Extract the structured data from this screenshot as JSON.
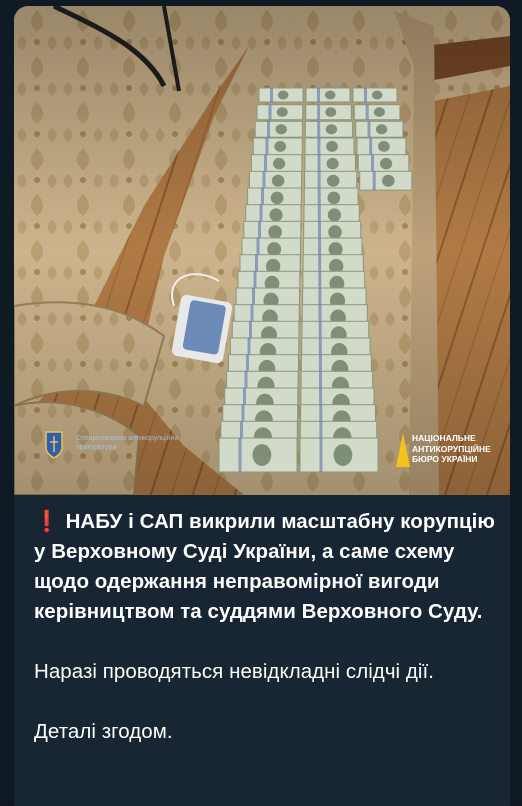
{
  "photo": {
    "description_icon": "photo-image",
    "sap_logo_text": "Спеціалізована антикорупційна прокуратура",
    "nabu_logo_text": "НАЦІОНАЛЬНЕ\nАНТИКОРУПЦІЙНЕ\nБЮРО УКРАЇНИ",
    "sofa_color": "#cdb48c",
    "floor_color": "#b5834e",
    "money_color": "#cfd7c6"
  },
  "message": {
    "exclamation": "❗",
    "bold_text": "НАБУ і САП викрили масштабну корупцію у Верховному Суді України, а саме схему щодо одержання неправомірної вигоди керівництвом та суддями Верховного Суду.",
    "para2": "Наразі проводяться невідкладні слідчі дії.",
    "para3": "Деталі згодом."
  },
  "colors": {
    "bubble": "#182533",
    "background": "#0f1a24",
    "text": "#ffffff",
    "accent_red": "#e53935"
  }
}
